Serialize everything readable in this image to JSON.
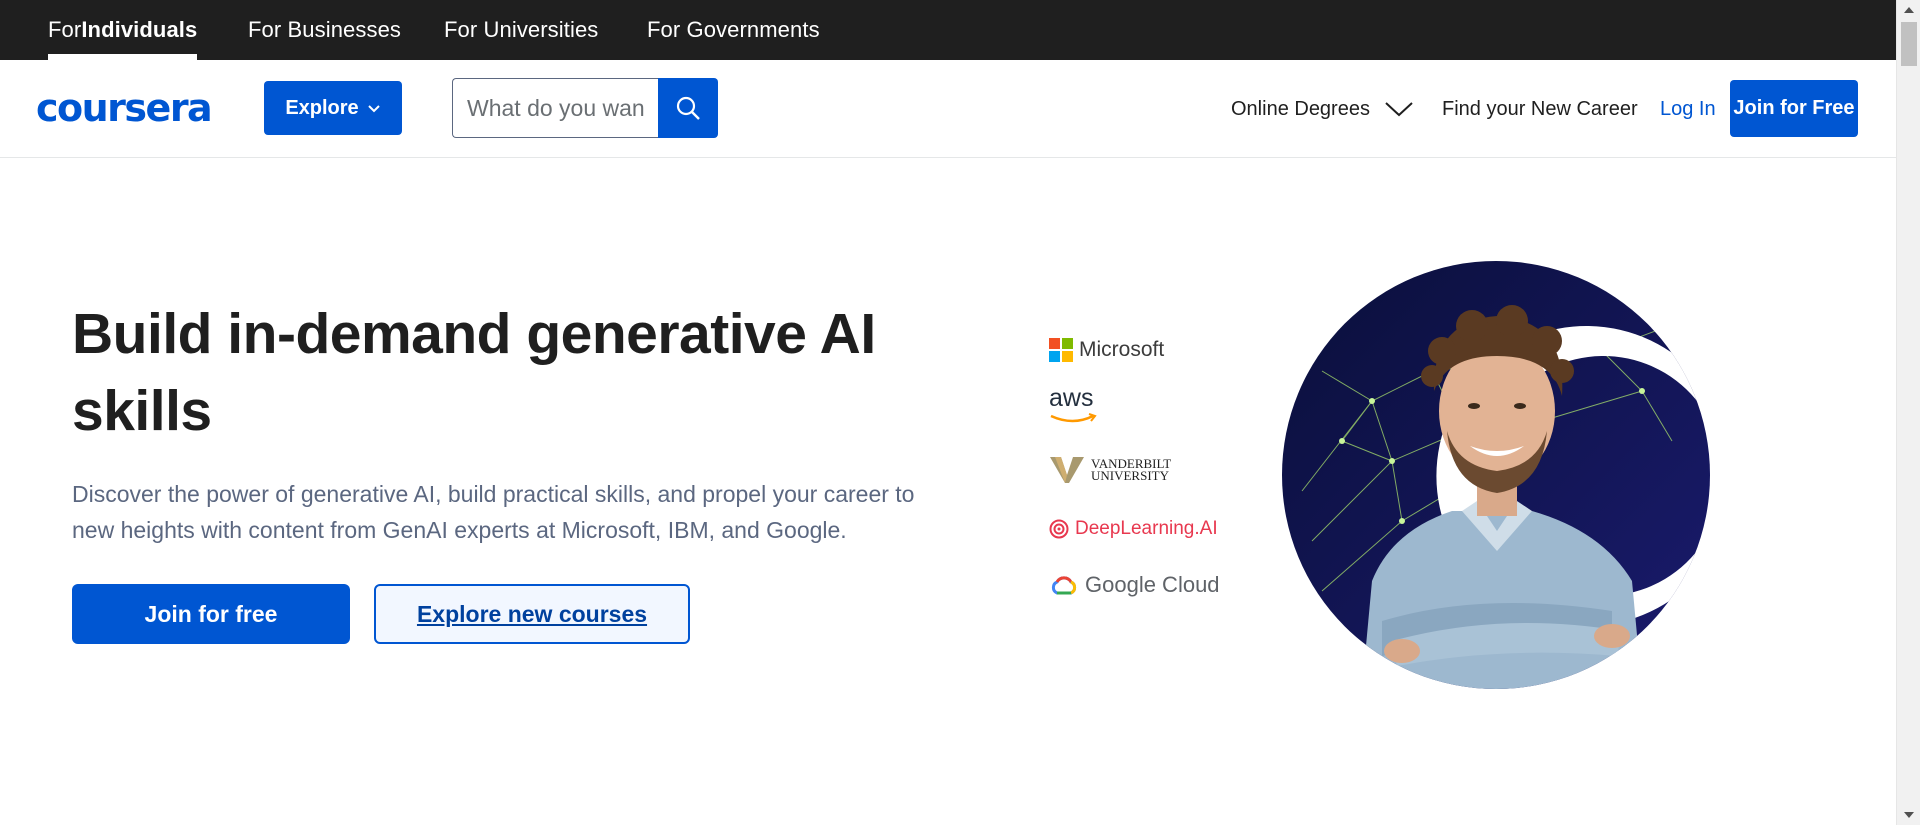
{
  "audience_tabs": [
    {
      "prefix": "For ",
      "label": "Individuals",
      "active": true
    },
    {
      "label": "For Businesses"
    },
    {
      "label": "For Universities"
    },
    {
      "label": "For Governments"
    }
  ],
  "header": {
    "logo_text": "coursera",
    "explore_label": "Explore",
    "search_placeholder": "What do you want to learn?",
    "online_degrees": "Online Degrees",
    "find_career": "Find your New Career",
    "login": "Log In",
    "join": "Join for Free"
  },
  "hero": {
    "title": "Build in-demand generative AI skills",
    "subtitle": "Discover the power of generative AI, build practical skills, and propel your career to new heights with content from GenAI experts at Microsoft, IBM, and Google.",
    "cta_primary": "Join for free",
    "cta_secondary": "Explore new courses"
  },
  "partners": [
    {
      "name": "Microsoft"
    },
    {
      "name": "aws"
    },
    {
      "name_line1": "VANDERBILT",
      "name_line2": "UNIVERSITY"
    },
    {
      "name": "DeepLearning.AI"
    },
    {
      "name": "Google Cloud"
    }
  ],
  "colors": {
    "brand_blue": "#0056d2",
    "top_bar": "#1f1f1f"
  },
  "icons": {
    "search": "search-icon",
    "chevron": "chevron-down-icon"
  }
}
